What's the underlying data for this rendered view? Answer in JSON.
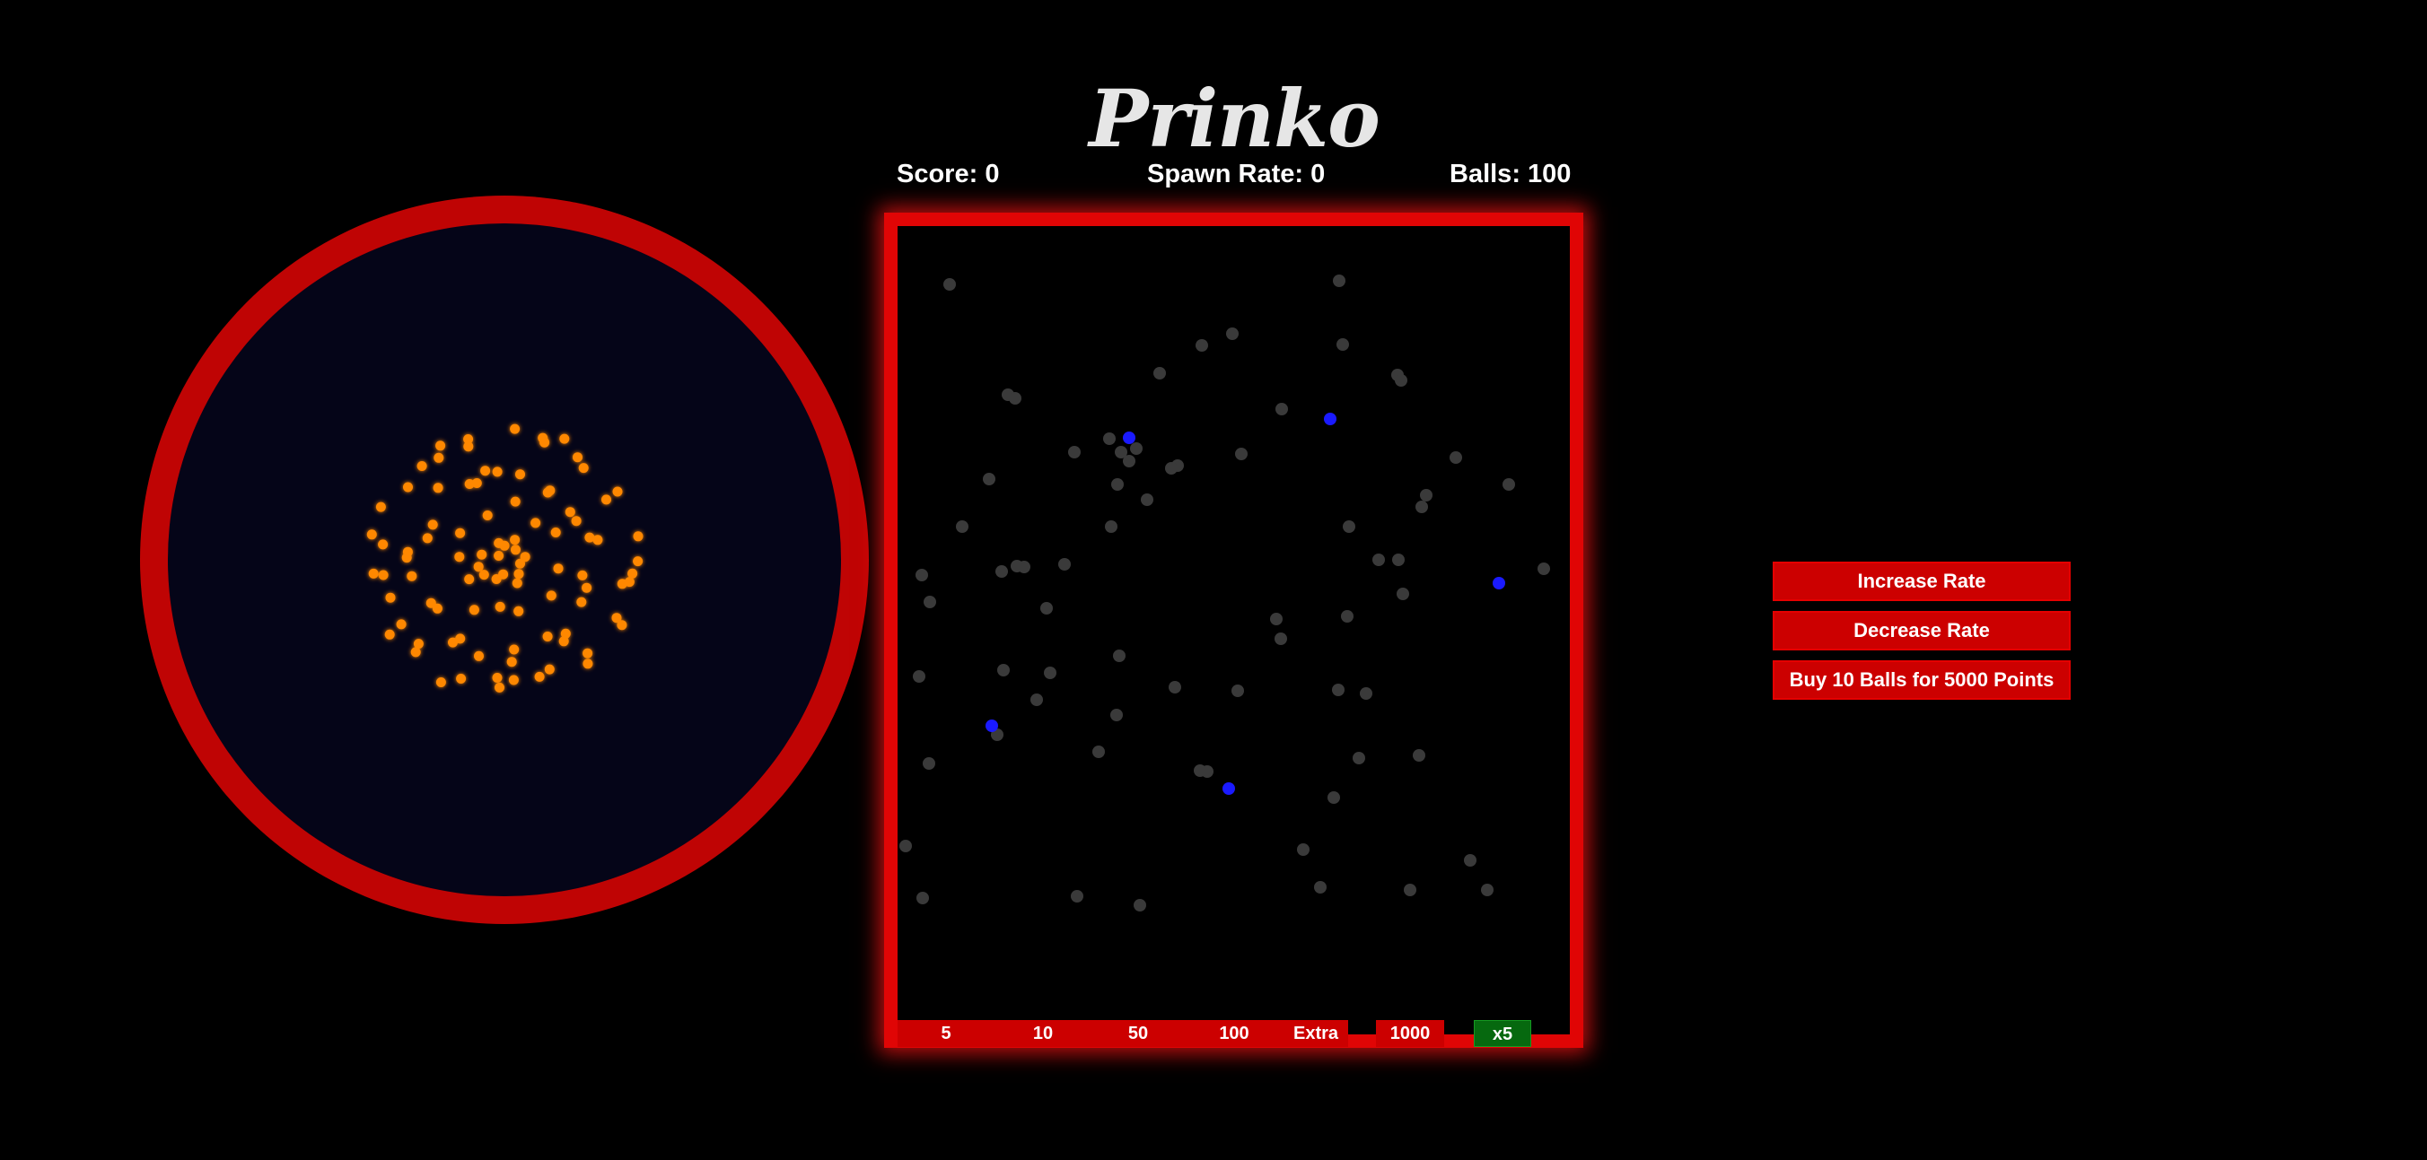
{
  "game": {
    "title": "Prinko"
  },
  "stats": {
    "score": "Score: 0",
    "spawn_rate": "Spawn Rate: 0",
    "balls": "Balls: 100"
  },
  "colors": {
    "background": "#000000",
    "accent_red": "#cc0000",
    "board_border": "#e00505",
    "orbit_ring": "#bf0404",
    "orbit_fill": "#050518",
    "orbit_particle": "#ff8800",
    "peg": "#3a3a3a",
    "active_peg": "#1a1aff",
    "bonus_bucket": "#06690f"
  },
  "board": {
    "buckets": [
      {
        "label": "5",
        "kind": "points"
      },
      {
        "label": "10",
        "kind": "points"
      },
      {
        "label": "50",
        "kind": "points"
      },
      {
        "label": "100",
        "kind": "points"
      },
      {
        "label": "Extra",
        "kind": "points"
      },
      {
        "label": "1000",
        "kind": "points"
      },
      {
        "label": "x5",
        "kind": "bonus"
      }
    ]
  },
  "controls": {
    "increase_label": "Increase Rate",
    "decrease_label": "Decrease Rate",
    "buy_label": "Buy 10 Balls for 5000 Points"
  }
}
